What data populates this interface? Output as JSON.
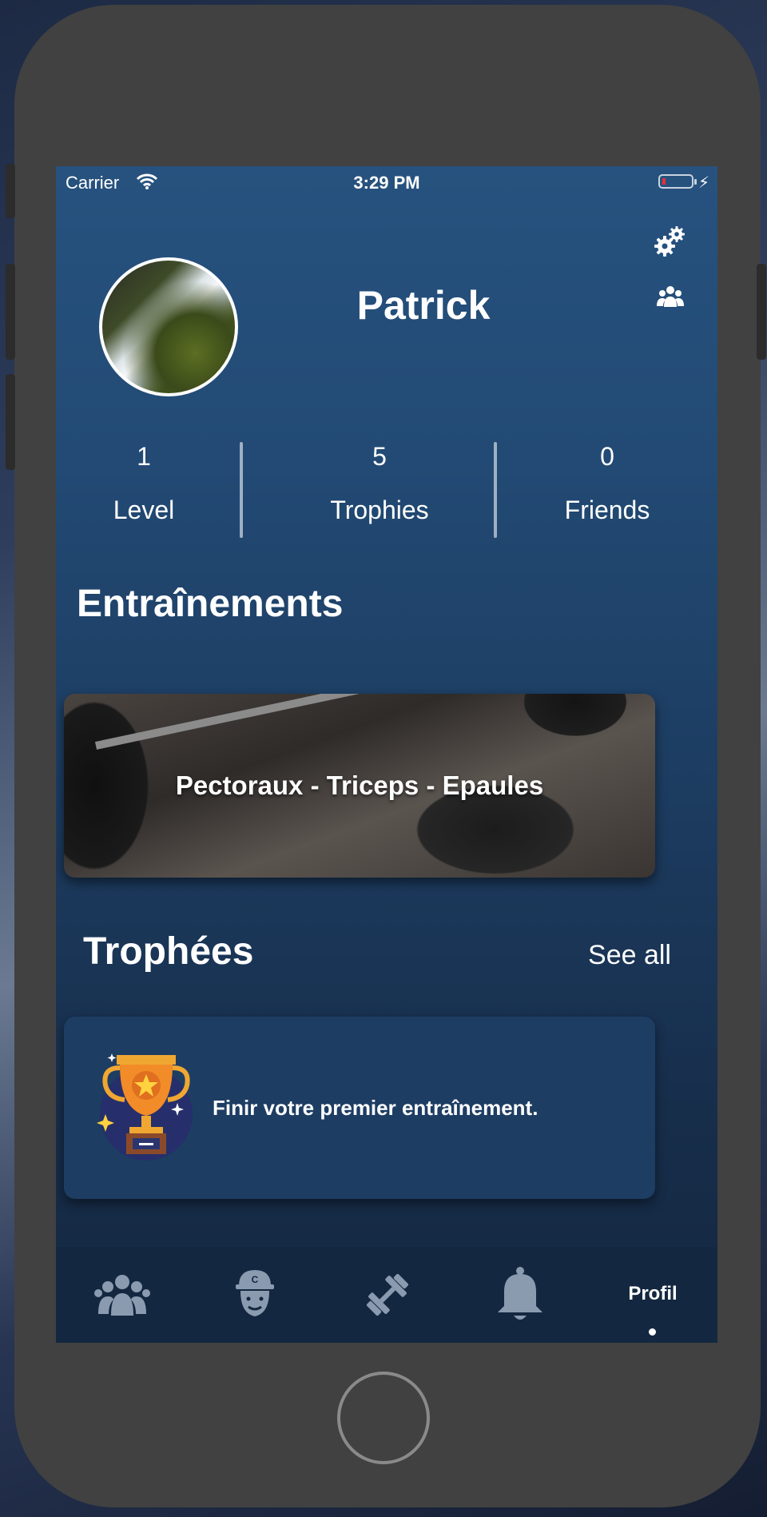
{
  "status_bar": {
    "carrier": "Carrier",
    "time": "3:29 PM"
  },
  "profile": {
    "name": "Patrick"
  },
  "stats": [
    {
      "value": "1",
      "label": "Level"
    },
    {
      "value": "5",
      "label": "Trophies"
    },
    {
      "value": "0",
      "label": "Friends"
    }
  ],
  "trainings": {
    "heading": "Entraînements",
    "card_title": "Pectoraux - Triceps - Epaules"
  },
  "trophies": {
    "heading": "Trophées",
    "see_all": "See all",
    "card_text": "Finir votre premier entraînement."
  },
  "tabbar": {
    "active_label": "Profil"
  },
  "icons": [
    "wifi-icon",
    "battery-icon",
    "gear-icon",
    "friends-icon",
    "trophy-icon",
    "community-icon",
    "coach-icon",
    "dumbbell-icon",
    "bell-icon"
  ],
  "colors": {
    "screen_top": "#27527f",
    "screen_bottom": "#142740",
    "card_bg": "#1d3d63",
    "tab_icon": "#8a9bb0"
  }
}
